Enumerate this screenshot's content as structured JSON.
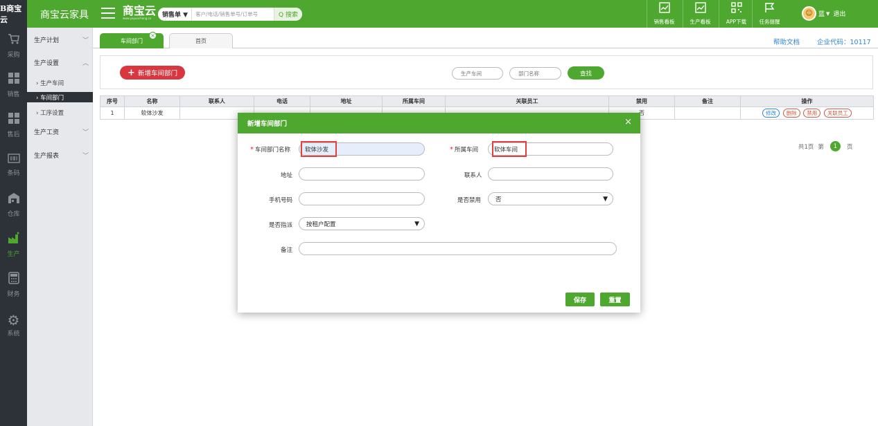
{
  "topbar": {
    "logo": "B商宝云",
    "app_title": "商宝云家具",
    "brand": "商宝云",
    "brand_sub": "www.yayuncheng.cn",
    "search_type": "销售单 ▼",
    "search_placeholder": "客户/电话/销售单号/订单号",
    "search_button": "Q 搜索",
    "nav": [
      {
        "label": "销售看板",
        "icon": "chart-icon"
      },
      {
        "label": "生产看板",
        "icon": "chart-icon"
      },
      {
        "label": "APP下载",
        "icon": "qrcode-icon"
      },
      {
        "label": "任务提醒",
        "icon": "flag-icon"
      }
    ],
    "user_name": "蓝",
    "user_caret": "▼",
    "logout": "退出"
  },
  "rail": [
    {
      "label": "采购",
      "icon": "cart-icon"
    },
    {
      "label": "销售",
      "icon": "grid-icon"
    },
    {
      "label": "售后",
      "icon": "grid-icon"
    },
    {
      "label": "条码",
      "icon": "barcode-icon"
    },
    {
      "label": "仓库",
      "icon": "warehouse-icon"
    },
    {
      "label": "生产",
      "icon": "factory-icon",
      "active": true
    },
    {
      "label": "财务",
      "icon": "calculator-icon"
    },
    {
      "label": "系统",
      "icon": "gear-icon"
    }
  ],
  "submenu": {
    "plan": "生产计划",
    "settings": "生产设置",
    "items": [
      "› 生产车间",
      "› 车间部门",
      "› 工序设置"
    ],
    "wage": "生产工资",
    "report": "生产报表"
  },
  "tabs": {
    "active": "车间部门",
    "home": "首页",
    "close": "×"
  },
  "header_links": {
    "help": "帮助文档",
    "company": "企业代码：10117"
  },
  "search_panel": {
    "add_button": "新增车间部门",
    "workshop_placeholder": "生产车间",
    "dept_placeholder": "部门名称",
    "find_button": "查找"
  },
  "table": {
    "headers": [
      "序号",
      "名称",
      "联系人",
      "电话",
      "地址",
      "所属车间",
      "关联员工",
      "禁用",
      "备注",
      "操作"
    ],
    "row": {
      "index": "1",
      "name": "软体沙发",
      "contact": "",
      "phone": "",
      "address": "",
      "workshop": "",
      "employees": "",
      "disabled": "否",
      "note": ""
    },
    "ops": [
      "修改",
      "删除",
      "禁用",
      "关联员工"
    ]
  },
  "pagination": {
    "total": "共1页",
    "prefix": "第",
    "current": "1",
    "suffix": "页"
  },
  "modal": {
    "title": "新增车间部门",
    "close": "×",
    "dept_name_label": "车间部门名称",
    "dept_name_value": "软体沙发",
    "workshop_label": "所属车间",
    "workshop_value": "软体车间",
    "address_label": "地址",
    "contact_label": "联系人",
    "phone_label": "手机号码",
    "disabled_label": "是否禁用",
    "disabled_value": "否",
    "assign_label": "是否指派",
    "assign_value": "按租户配置",
    "note_label": "备注",
    "save": "保存",
    "reset": "重置",
    "required_mark": "*"
  },
  "colors": {
    "brand_green": "#4ea72e",
    "dark_rail": "#2d3138",
    "danger_red": "#d9373f",
    "link_blue": "#2e84d6"
  }
}
